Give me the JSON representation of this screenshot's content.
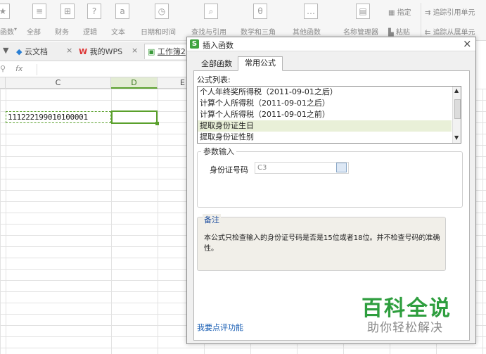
{
  "ribbon": {
    "groups": [
      {
        "label": "函数",
        "icon": "★"
      },
      {
        "label": "全部",
        "icon": "≡"
      },
      {
        "label": "财务",
        "icon": "⊞"
      },
      {
        "label": "逻辑",
        "icon": "?"
      },
      {
        "label": "文本",
        "icon": "a"
      },
      {
        "label": "日期和时间",
        "icon": "◷"
      },
      {
        "label": "查找与引用",
        "icon": "⌕"
      },
      {
        "label": "数学和三角",
        "icon": "θ"
      },
      {
        "label": "其他函数",
        "icon": "…"
      },
      {
        "label": "名称管理器",
        "icon": "▤"
      }
    ],
    "specify": "指定",
    "paste": "粘贴",
    "trace_precedents": "追踪引用单元",
    "trace_dependents": "追踪从属单元"
  },
  "tabs": {
    "cloud": "云文档",
    "mywps": "我的WPS",
    "workbook": "工作簿2"
  },
  "formula_bar": {
    "fx": "fx"
  },
  "columns": [
    "C",
    "D",
    "E"
  ],
  "cell_c": "111222199010100001",
  "dialog": {
    "title": "插入函数",
    "close": "×",
    "tab_all": "全部函数",
    "tab_common": "常用公式",
    "list_label": "公式列表:",
    "formulas": [
      "个人年终奖所得税（2011-09-01之后）",
      "计算个人所得税（2011-09-01之后）",
      "计算个人所得税（2011-09-01之前）",
      "提取身份证生日",
      "提取身份证性别"
    ],
    "selected_index": 3,
    "params_label": "参数输入",
    "id_label": "身份证号码",
    "id_value": "C3",
    "note_label": "备注",
    "note_text": "本公式只检查输入的身份证号码是否是15位或者18位。并不检查号码的准确性。",
    "feedback_link": "我要点评功能"
  },
  "watermark": {
    "title": "百科全说",
    "subtitle": "助你轻松解决"
  },
  "colors": {
    "accent_green": "#5aa02c",
    "watermark_green": "#2e9e3e",
    "link_blue": "#1a5fb4",
    "selection": "#e9f0d8"
  }
}
